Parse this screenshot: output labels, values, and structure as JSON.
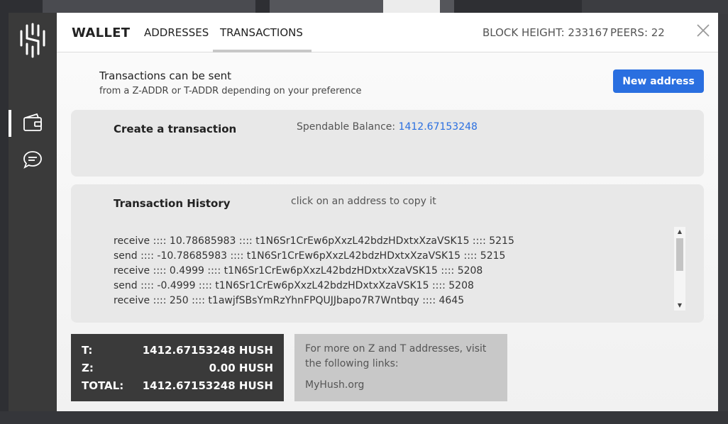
{
  "colors": {
    "accent": "#2a6fe0",
    "sidebar": "#3a3a3a",
    "panel": "#e8e8e8",
    "info_box": "#c8c8c8"
  },
  "sidebar": {
    "logo_icon": "hush-logo-icon",
    "items": [
      {
        "icon": "wallet-icon",
        "active": true
      },
      {
        "icon": "chat-icon",
        "active": false
      }
    ]
  },
  "header": {
    "brand": "WALLET",
    "tabs": [
      {
        "label": "ADDRESSES",
        "active": false
      },
      {
        "label": "TRANSACTIONS",
        "active": true
      }
    ],
    "block_height": "BLOCK HEIGHT: 233167",
    "peers": "PEERS: 22",
    "close_icon": "close-icon"
  },
  "intro": {
    "title": "Transactions can be sent",
    "subtitle": "from a Z-ADDR or T-ADDR depending on your preference",
    "new_address_label": "New address"
  },
  "create": {
    "title": "Create a transaction",
    "balance_label": "Spendable Balance: ",
    "balance_value": "1412.67153248"
  },
  "history": {
    "title": "Transaction History",
    "hint": "click on an address to copy it",
    "rows": [
      "receive :::: 10.78685983 :::: t1N6Sr1CrEw6pXxzL42bdzHDxtxXzaVSK15 :::: 5215",
      "send :::: -10.78685983 :::: t1N6Sr1CrEw6pXxzL42bdzHDxtxXzaVSK15 :::: 5215",
      "receive :::: 0.4999 :::: t1N6Sr1CrEw6pXxzL42bdzHDxtxXzaVSK15 :::: 5208",
      "send :::: -0.4999 :::: t1N6Sr1CrEw6pXxzL42bdzHDxtxXzaVSK15 :::: 5208",
      "receive :::: 250 :::: t1awjfSBsYmRzYhnFPQUJJbapo7R7Wntbqy :::: 4645"
    ]
  },
  "totals": {
    "t_label": "T:",
    "t_value": "1412.67153248 HUSH",
    "z_label": "Z:",
    "z_value": "0.00 HUSH",
    "total_label": "TOTAL:",
    "total_value": "1412.67153248 HUSH"
  },
  "info": {
    "text": "For more on Z and T addresses, visit the following links:",
    "link": "MyHush.org"
  }
}
